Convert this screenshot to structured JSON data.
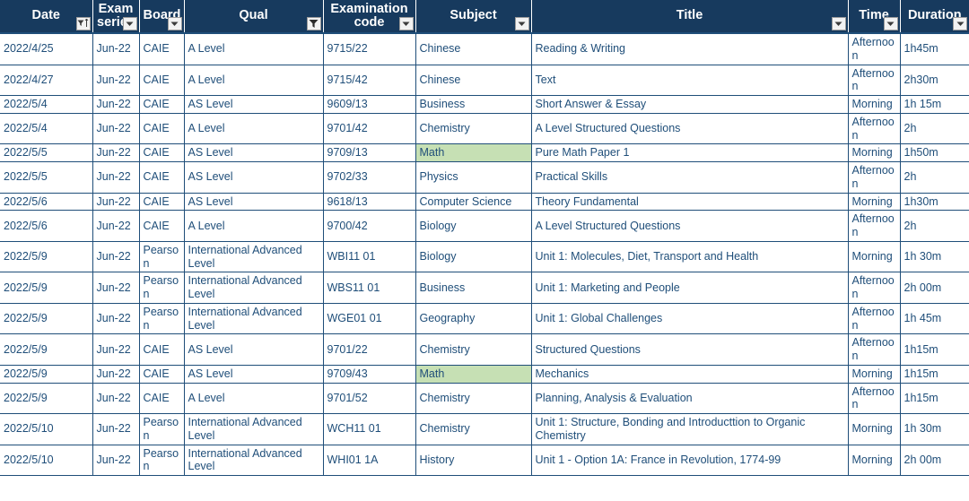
{
  "table": {
    "columns": [
      {
        "label": "Date",
        "key": "date",
        "icon": "filter-sort-icon",
        "filtered": false
      },
      {
        "label": "Exam series",
        "key": "series",
        "icon": "chevron-down-icon",
        "filtered": false
      },
      {
        "label": "Board",
        "key": "board",
        "icon": "chevron-down-icon",
        "filtered": false
      },
      {
        "label": "Qual",
        "key": "qual",
        "icon": "funnel-icon",
        "filtered": true
      },
      {
        "label": "Examination code",
        "key": "code",
        "icon": "chevron-down-icon",
        "filtered": false
      },
      {
        "label": "Subject",
        "key": "subject",
        "icon": "chevron-down-icon",
        "filtered": false
      },
      {
        "label": "Title",
        "key": "title",
        "icon": "chevron-down-icon",
        "filtered": false
      },
      {
        "label": "Time",
        "key": "time",
        "icon": "chevron-down-icon",
        "filtered": false
      },
      {
        "label": "Duration",
        "key": "duration",
        "icon": "chevron-down-icon",
        "filtered": false
      }
    ],
    "highlight_color": "#C6E0B4",
    "header_color": "#173A5E",
    "text_color": "#1F4E79",
    "rows": [
      {
        "date": "2022/4/25",
        "series": "Jun-22",
        "board": "CAIE",
        "qual": "A Level",
        "code": "9715/22",
        "subject": "Chinese",
        "title": "Reading & Writing",
        "time": "Afternoon",
        "duration": "1h45m",
        "highlight": false
      },
      {
        "date": "2022/4/27",
        "series": "Jun-22",
        "board": "CAIE",
        "qual": "A Level",
        "code": "9715/42",
        "subject": "Chinese",
        "title": "Text",
        "time": "Afternoon",
        "duration": "2h30m",
        "highlight": false
      },
      {
        "date": "2022/5/4",
        "series": "Jun-22",
        "board": "CAIE",
        "qual": "AS Level",
        "code": "9609/13",
        "subject": "Business",
        "title": "Short Answer & Essay",
        "time": "Morning",
        "duration": "1h 15m",
        "highlight": false
      },
      {
        "date": "2022/5/4",
        "series": "Jun-22",
        "board": "CAIE",
        "qual": "A Level",
        "code": "9701/42",
        "subject": "Chemistry",
        "title": "A Level Structured Questions",
        "time": "Afternoon",
        "duration": "2h",
        "highlight": false
      },
      {
        "date": "2022/5/5",
        "series": "Jun-22",
        "board": "CAIE",
        "qual": "AS Level",
        "code": "9709/13",
        "subject": "Math",
        "title": "Pure Math Paper 1",
        "time": "Morning",
        "duration": "1h50m",
        "highlight": true
      },
      {
        "date": "2022/5/5",
        "series": "Jun-22",
        "board": "CAIE",
        "qual": "AS Level",
        "code": "9702/33",
        "subject": "Physics",
        "title": "Practical Skills",
        "time": "Afternoon",
        "duration": "2h",
        "highlight": false
      },
      {
        "date": "2022/5/6",
        "series": "Jun-22",
        "board": "CAIE",
        "qual": "AS Level",
        "code": "9618/13",
        "subject": "Computer Science",
        "title": "Theory Fundamental",
        "time": "Morning",
        "duration": "1h30m",
        "highlight": false
      },
      {
        "date": "2022/5/6",
        "series": "Jun-22",
        "board": "CAIE",
        "qual": "A Level",
        "code": "9700/42",
        "subject": "Biology",
        "title": "A Level Structured Questions",
        "time": "Afternoon",
        "duration": "2h",
        "highlight": false
      },
      {
        "date": "2022/5/9",
        "series": "Jun-22",
        "board": "Pearson",
        "qual": "International Advanced Level",
        "code": "WBI11 01",
        "subject": "Biology",
        "title": "Unit 1: Molecules, Diet, Transport and Health",
        "time": "Morning",
        "duration": "1h 30m",
        "highlight": false
      },
      {
        "date": "2022/5/9",
        "series": "Jun-22",
        "board": "Pearson",
        "qual": "International Advanced Level",
        "code": "WBS11 01",
        "subject": "Business",
        "title": "Unit 1: Marketing and People",
        "time": "Afternoon",
        "duration": "2h 00m",
        "highlight": false
      },
      {
        "date": "2022/5/9",
        "series": "Jun-22",
        "board": "Pearson",
        "qual": "International Advanced Level",
        "code": "WGE01 01",
        "subject": "Geography",
        "title": "Unit 1: Global Challenges",
        "time": "Afternoon",
        "duration": "1h 45m",
        "highlight": false
      },
      {
        "date": "2022/5/9",
        "series": "Jun-22",
        "board": "CAIE",
        "qual": "AS Level",
        "code": "9701/22",
        "subject": "Chemistry",
        "title": "Structured Questions",
        "time": "Afternoon",
        "duration": "1h15m",
        "highlight": false
      },
      {
        "date": "2022/5/9",
        "series": "Jun-22",
        "board": "CAIE",
        "qual": "AS Level",
        "code": "9709/43",
        "subject": "Math",
        "title": "Mechanics",
        "time": "Morning",
        "duration": "1h15m",
        "highlight": true
      },
      {
        "date": "2022/5/9",
        "series": "Jun-22",
        "board": "CAIE",
        "qual": "A Level",
        "code": "9701/52",
        "subject": "Chemistry",
        "title": "Planning, Analysis & Evaluation",
        "time": "Afternoon",
        "duration": "1h15m",
        "highlight": false
      },
      {
        "date": "2022/5/10",
        "series": "Jun-22",
        "board": "Pearson",
        "qual": "International Advanced Level",
        "code": "WCH11 01",
        "subject": "Chemistry",
        "title": "Unit 1: Structure, Bonding and Introducttion to Organic Chemistry",
        "time": "Morning",
        "duration": "1h 30m",
        "highlight": false
      },
      {
        "date": "2022/5/10",
        "series": "Jun-22",
        "board": "Pearson",
        "qual": "International Advanced Level",
        "code": "WHI01 1A",
        "subject": "History",
        "title": "Unit 1 - Option 1A: France in Revolution, 1774-99",
        "time": "Morning",
        "duration": "2h 00m",
        "highlight": false
      }
    ]
  }
}
